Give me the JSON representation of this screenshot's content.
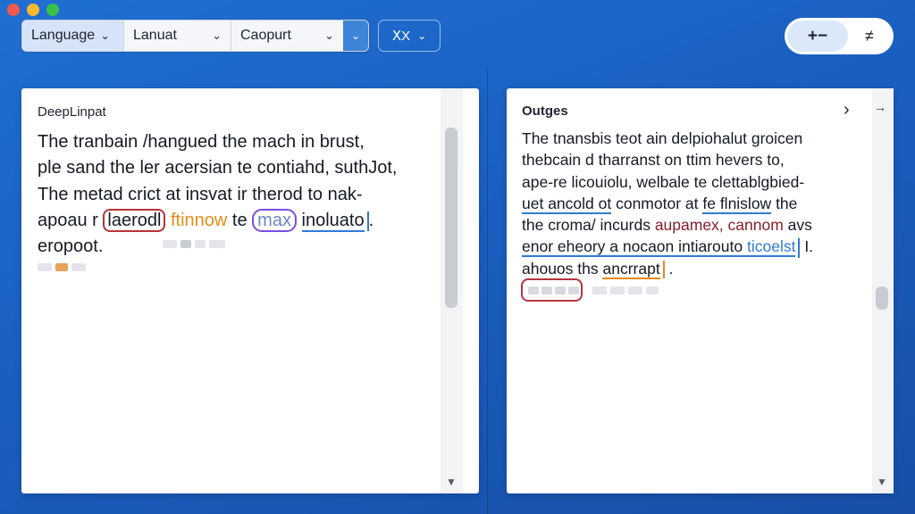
{
  "toolbar": {
    "language_label": "Language",
    "source_select": "Lanuat",
    "target_select": "Caopurt",
    "format_label": "ⅩX"
  },
  "right_controls": {
    "primary_label": "+−",
    "secondary_label": "≠"
  },
  "input_panel": {
    "title": "DeepLinpat",
    "lines": [
      [
        "The tranbain /hangued the mach in brust,"
      ],
      [
        "ple sand the ler acersian te contiahd, suthJot,"
      ],
      [
        "The metad crict at insvat ir therod to nak-"
      ],
      [
        "apoau r ",
        "laerodl",
        " ",
        "ftinnow",
        " te ",
        "max",
        " ",
        "inoluato",
        "."
      ],
      [
        "eropoot."
      ]
    ]
  },
  "output_panel": {
    "title": "Outges",
    "lines": [
      "The tnansbis teot ain delpiohalut groicen",
      "thebcain d tharranst on ttim hevers to,",
      "ape-re licouiolu, welbale te clettablgbied-",
      [
        "uet ancold ot",
        " conmotor at ",
        "fe flnislow",
        " the"
      ],
      [
        "the croma/ incurds ",
        "aupamex, cannom",
        " avs"
      ],
      [
        "enor eheory a nocaon intiarouto ",
        "ticoelst",
        " I."
      ],
      [
        "ahouos ths ",
        "ancrrapt",
        " ."
      ]
    ]
  },
  "colors": {
    "accent": "#3d85d8",
    "background": "#1f6fd1",
    "highlight_red": "#b5343c",
    "highlight_purple": "#7a4fe0",
    "highlight_orange": "#e48b19"
  }
}
